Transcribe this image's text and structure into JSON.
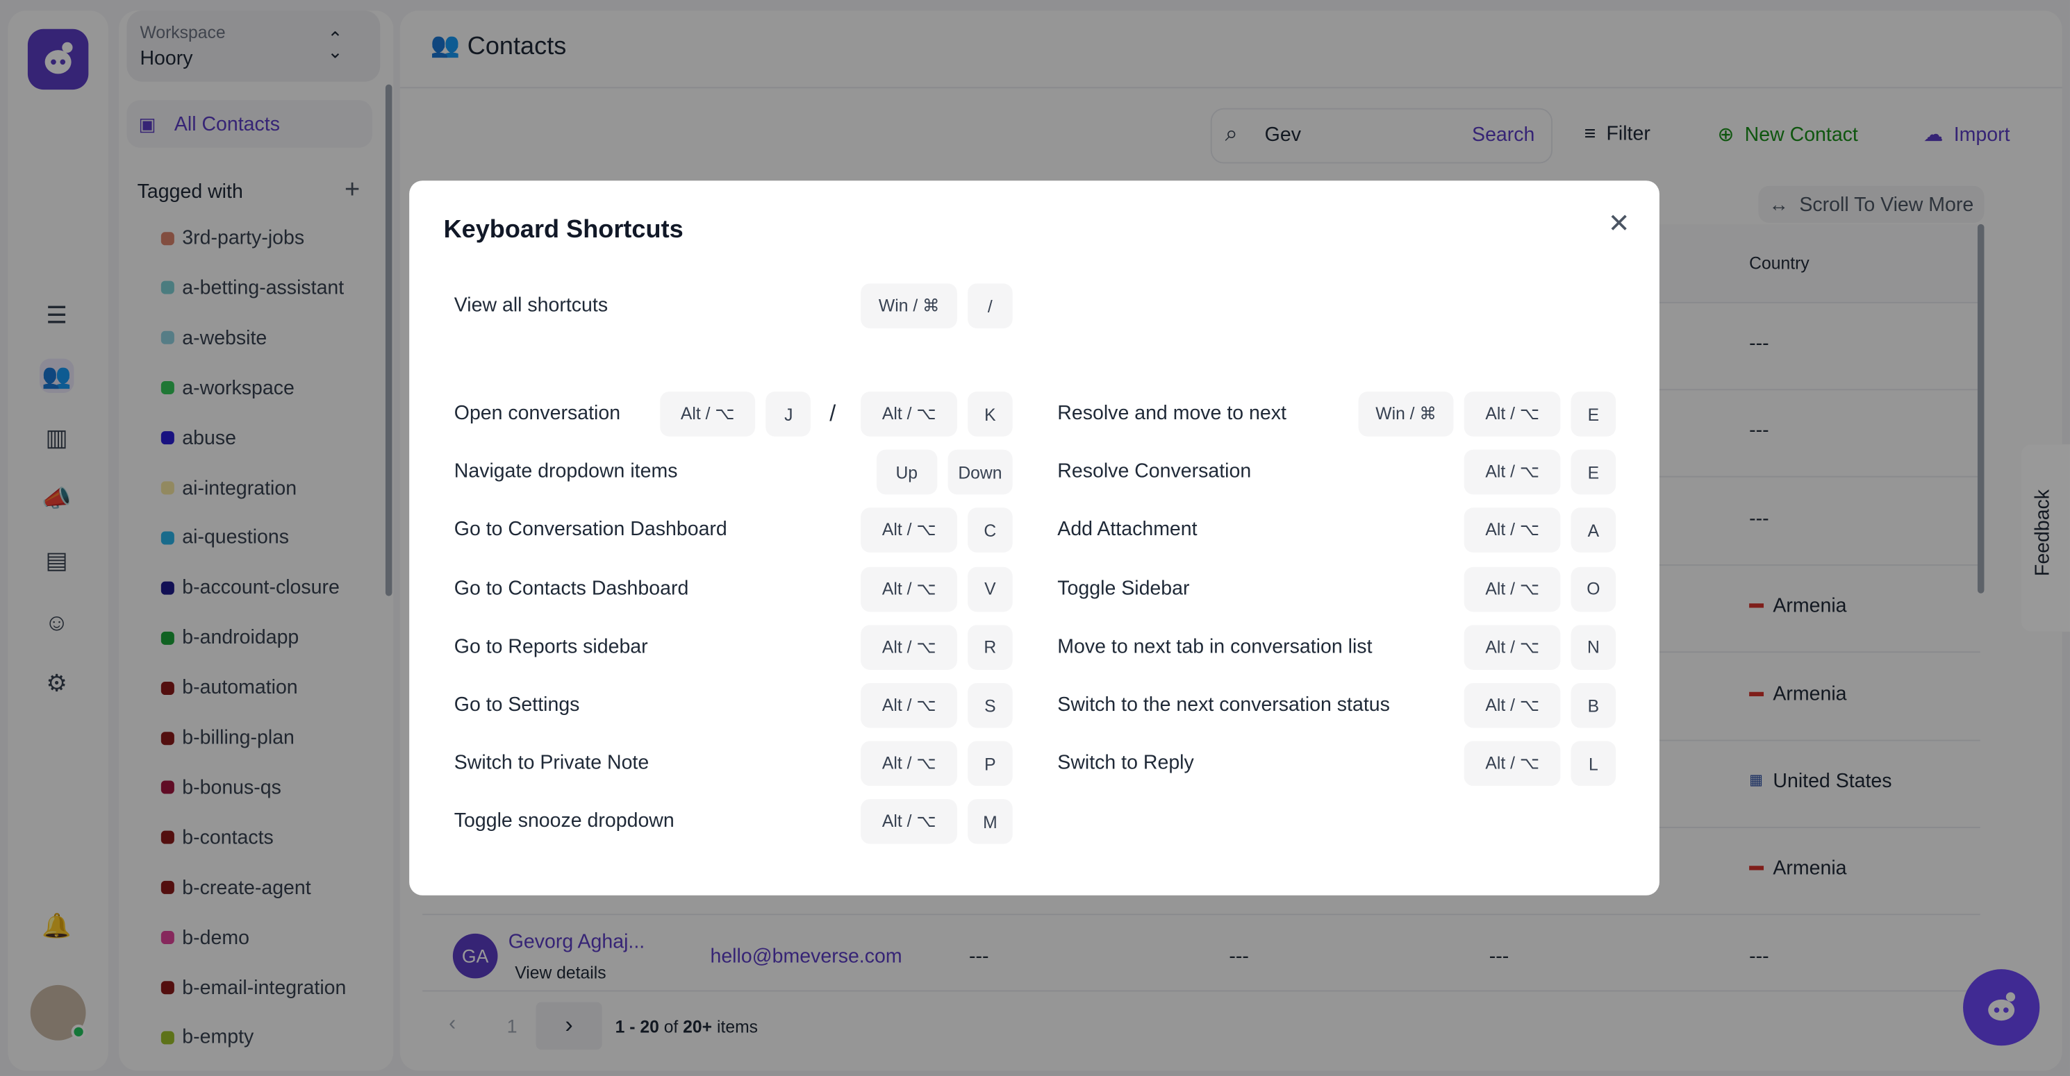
{
  "workspace": {
    "label": "Workspace",
    "name": "Hoory"
  },
  "sidebar": {
    "all_contacts": "All Contacts",
    "tagged_with": "Tagged with",
    "tags": [
      {
        "name": "3rd-party-jobs",
        "color": "#d9826b"
      },
      {
        "name": "a-betting-assistant",
        "color": "#7ecfd4"
      },
      {
        "name": "a-website",
        "color": "#8fd0e0"
      },
      {
        "name": "a-workspace",
        "color": "#34c759"
      },
      {
        "name": "abuse",
        "color": "#2a1fd6"
      },
      {
        "name": "ai-integration",
        "color": "#f4e4a0"
      },
      {
        "name": "ai-questions",
        "color": "#2ab3e8"
      },
      {
        "name": "b-account-closure",
        "color": "#1e1b8c"
      },
      {
        "name": "b-androidapp",
        "color": "#1ba33a"
      },
      {
        "name": "b-automation",
        "color": "#8b1a1a"
      },
      {
        "name": "b-billing-plan",
        "color": "#8b1a1a"
      },
      {
        "name": "b-bonus-qs",
        "color": "#a0153e"
      },
      {
        "name": "b-contacts",
        "color": "#8b1a1a"
      },
      {
        "name": "b-create-agent",
        "color": "#8b1a1a"
      },
      {
        "name": "b-demo",
        "color": "#e0449a"
      },
      {
        "name": "b-email-integration",
        "color": "#8b1a1a"
      },
      {
        "name": "b-empty",
        "color": "#9bbf2a"
      }
    ]
  },
  "header": {
    "title": "Contacts"
  },
  "toolbar": {
    "search_value": "Gev",
    "search_button": "Search",
    "filter": "Filter",
    "new_contact": "New Contact",
    "import": "Import",
    "scroll_hint": "Scroll To View More"
  },
  "table": {
    "country_header": "Country",
    "countries": [
      "---",
      "---",
      "---",
      "Armenia",
      "Armenia",
      "United States",
      "Armenia"
    ],
    "last_row": {
      "initials": "GA",
      "name": "Gevorg Aghaj...",
      "view_details": "View details",
      "email": "hello@bmeverse.com",
      "cells": [
        "---",
        "---",
        "---",
        "---"
      ]
    }
  },
  "pagination": {
    "page": "1",
    "range": "1 - 20",
    "of": " of ",
    "total": "20+",
    "items": " items"
  },
  "feedback": "Feedback",
  "modal": {
    "title": "Keyboard Shortcuts",
    "view_all": {
      "label": "View all shortcuts",
      "keys": [
        "Win / ⌘",
        "/"
      ]
    },
    "left": [
      {
        "label": "Open conversation",
        "keys": [
          "Alt / ⌥",
          "J",
          "/",
          "Alt / ⌥",
          "K"
        ]
      },
      {
        "label": "Navigate dropdown items",
        "keys": [
          "Up",
          "Down"
        ]
      },
      {
        "label": "Go to Conversation Dashboard",
        "keys": [
          "Alt / ⌥",
          "C"
        ]
      },
      {
        "label": "Go to Contacts Dashboard",
        "keys": [
          "Alt / ⌥",
          "V"
        ]
      },
      {
        "label": "Go to Reports sidebar",
        "keys": [
          "Alt / ⌥",
          "R"
        ]
      },
      {
        "label": "Go to Settings",
        "keys": [
          "Alt / ⌥",
          "S"
        ]
      },
      {
        "label": "Switch to Private Note",
        "keys": [
          "Alt / ⌥",
          "P"
        ]
      },
      {
        "label": "Toggle snooze dropdown",
        "keys": [
          "Alt / ⌥",
          "M"
        ]
      }
    ],
    "right": [
      {
        "label": "Resolve and move to next",
        "keys": [
          "Win / ⌘",
          "Alt / ⌥",
          "E"
        ]
      },
      {
        "label": "Resolve Conversation",
        "keys": [
          "Alt / ⌥",
          "E"
        ]
      },
      {
        "label": "Add Attachment",
        "keys": [
          "Alt / ⌥",
          "A"
        ]
      },
      {
        "label": "Toggle Sidebar",
        "keys": [
          "Alt / ⌥",
          "O"
        ]
      },
      {
        "label": "Move to next tab in conversation list",
        "keys": [
          "Alt / ⌥",
          "N"
        ]
      },
      {
        "label": "Switch to the next conversation status",
        "keys": [
          "Alt / ⌥",
          "B"
        ]
      },
      {
        "label": "Switch to Reply",
        "keys": [
          "Alt / ⌥",
          "L"
        ]
      }
    ]
  },
  "colors": {
    "brand": "#5b3cc4",
    "green": "#1a8f1a",
    "fab": "#6b46f5"
  }
}
